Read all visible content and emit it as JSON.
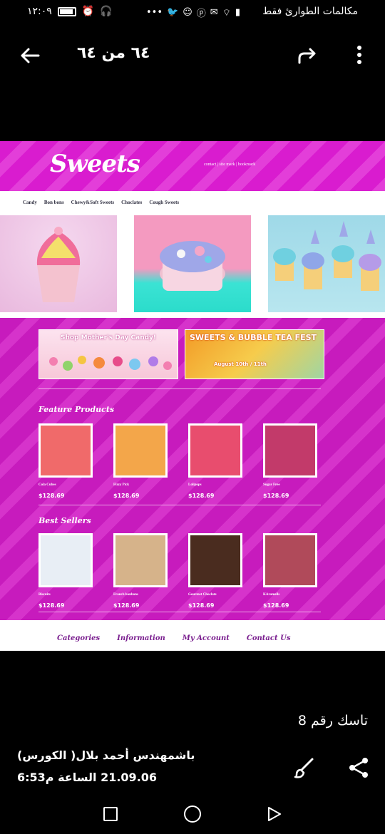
{
  "status_bar": {
    "time": "١٢:٠٩",
    "carrier": "مكالمات الطوارئ فقط",
    "icons": [
      "battery-icon",
      "alarm-icon",
      "headphones-icon",
      "overflow-dots-icon",
      "twitter-icon",
      "app-icon",
      "pinterest-icon",
      "gmail-icon",
      "wifi-icon",
      "signal-icon"
    ]
  },
  "app_bar": {
    "counter": "٦٤ من ٦٤"
  },
  "webpage": {
    "logo": "Sweets",
    "header_links": "contact | site mark | bookmark",
    "nav": [
      "Candy",
      "Bon bons",
      "Chewy&Soft Sweets",
      "Choclates",
      "Cough Sweets"
    ],
    "banners": [
      "Shop Mother's Day Candy!",
      "SWEETS & BUBBLE TEA FEST",
      "August 10th / 11th"
    ],
    "featured_title": "Feature Products",
    "featured": [
      {
        "name": "Cola Cubes",
        "price": "$128.69",
        "color": "#f06a6a"
      },
      {
        "name": "Fizzy Pick",
        "price": "$128.69",
        "color": "#f3a64a"
      },
      {
        "name": "Lolipops",
        "price": "$128.69",
        "color": "#e84d6e"
      },
      {
        "name": "Sugar Free",
        "price": "$128.69",
        "color": "#c23a6a"
      }
    ],
    "bestsellers_title": "Best Sellers",
    "bestsellers": [
      {
        "name": "Biscuits",
        "price": "$128.69",
        "color": "#e8eef5"
      },
      {
        "name": "Franch bonbons",
        "price": "$128.69",
        "color": "#d6b38a"
      },
      {
        "name": "Gourmet Choclate",
        "price": "$128.69",
        "color": "#4a2c1f"
      },
      {
        "name": "KAramells",
        "price": "$128.69",
        "color": "#b04a5a"
      }
    ],
    "footer": [
      "Categories",
      "Information",
      "My Account",
      "Contact Us"
    ]
  },
  "caption": {
    "title": "تاسك رقم 8",
    "author": "باشمهندس أحمد بلال( الكورس)",
    "date": "21.09.06 الساعة م6:53"
  }
}
